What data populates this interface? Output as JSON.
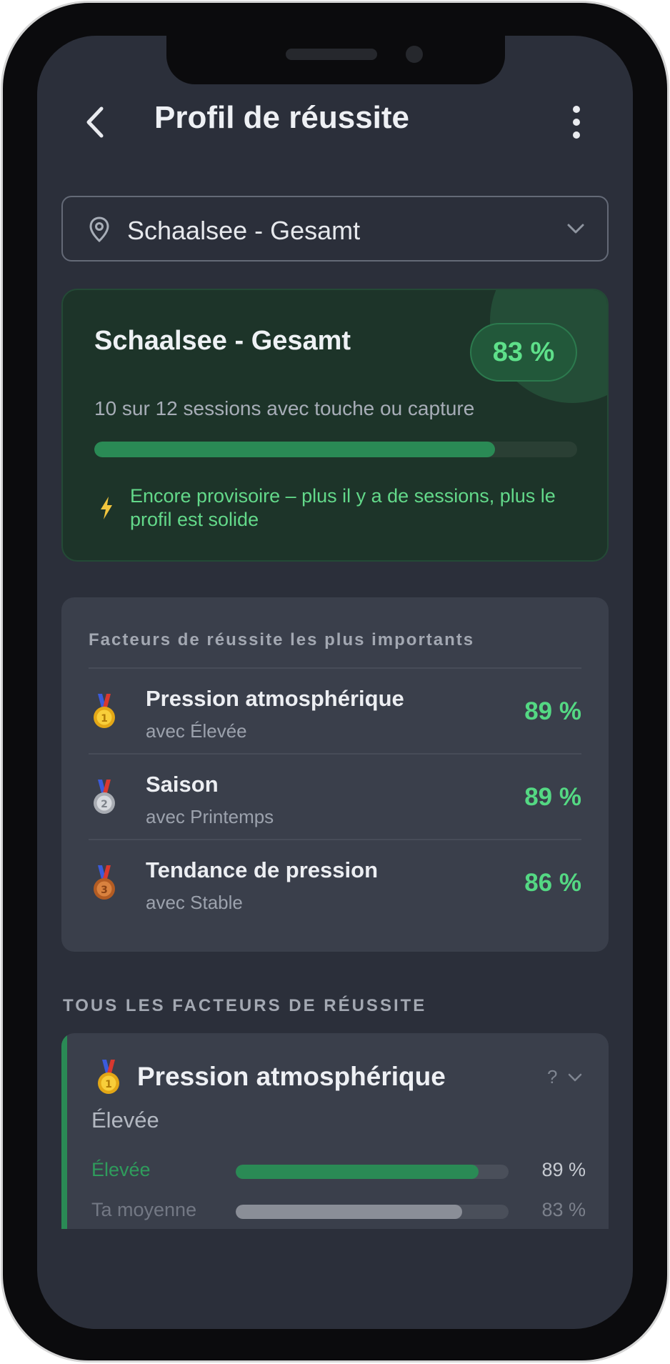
{
  "header": {
    "title": "Profil de réussite",
    "back_icon": "chevron-left-icon",
    "menu_icon": "more-vertical-icon"
  },
  "location_select": {
    "value": "Schaalsee - Gesamt",
    "icon": "map-pin-icon",
    "chevron_icon": "chevron-down-icon"
  },
  "summary": {
    "title": "Schaalsee - Gesamt",
    "rate_label": "83 %",
    "rate_fraction": 0.83,
    "sessions_text": "10 sur 12 sessions avec touche ou capture",
    "note": "Encore provisoire – plus il y a de sessions, plus le profil est solide",
    "note_icon": "lightning-bolt-icon"
  },
  "top_factors": {
    "heading": "Facteurs de réussite les plus importants",
    "items": [
      {
        "rank": 1,
        "medal": "gold-medal-icon",
        "title": "Pression atmosphérique",
        "subtitle": "avec Élevée",
        "value": "89 %"
      },
      {
        "rank": 2,
        "medal": "silver-medal-icon",
        "title": "Saison",
        "subtitle": "avec Printemps",
        "value": "89 %"
      },
      {
        "rank": 3,
        "medal": "bronze-medal-icon",
        "title": "Tendance de pression",
        "subtitle": "avec Stable",
        "value": "86 %"
      }
    ]
  },
  "all_factors": {
    "heading": "TOUS LES FACTEURS DE RÉUSSITE",
    "factor": {
      "medal": "gold-medal-icon",
      "title": "Pression atmosphérique",
      "help_label": "?",
      "current_value": "Élevée",
      "rows": [
        {
          "label": "Élevée",
          "value": "89 %",
          "fraction": 0.89,
          "color": "#2a8a55",
          "label_color": "#2f9c5c",
          "value_color": "#c7cbd2"
        },
        {
          "label": "Ta moyenne",
          "value": "83 %",
          "fraction": 0.83,
          "color": "#8a8e97",
          "label_color": "#737884",
          "value_color": "#7c818c"
        }
      ]
    }
  },
  "colors": {
    "background": "#2b2f3a",
    "card": "#3a3f4b",
    "summary_card": "#1d3429",
    "accent_green": "#54d883",
    "bar_green": "#2a8a55"
  }
}
